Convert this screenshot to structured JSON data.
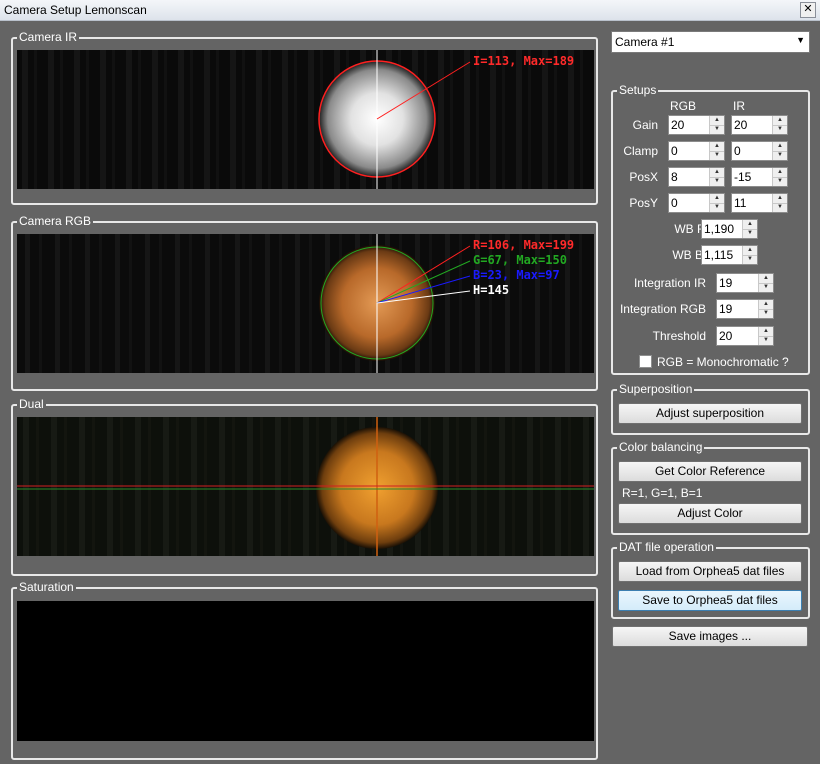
{
  "window": {
    "title": "Camera Setup Lemonscan",
    "close_glyph": "✕"
  },
  "panels": {
    "camera_ir": {
      "label": "Camera IR",
      "overlay": "I=113, Max=189"
    },
    "camera_rgb": {
      "label": "Camera RGB",
      "overlays": {
        "r": "R=106, Max=199",
        "g": "G=67, Max=150",
        "b": "B=23, Max=97",
        "h": "H=145"
      }
    },
    "dual": {
      "label": "Dual"
    },
    "saturation": {
      "label": "Saturation"
    }
  },
  "camera_select": {
    "value": "Camera #1",
    "arrow": "▼"
  },
  "setups": {
    "label": "Setups",
    "col_rgb": "RGB",
    "col_ir": "IR",
    "rows": {
      "gain": {
        "label": "Gain",
        "rgb": "20",
        "ir": "20"
      },
      "clamp": {
        "label": "Clamp",
        "rgb": "0",
        "ir": "0"
      },
      "posx": {
        "label": "PosX",
        "rgb": "8",
        "ir": "-15"
      },
      "posy": {
        "label": "PosY",
        "rgb": "0",
        "ir": "11"
      }
    },
    "wb_red": {
      "label": "WB Red",
      "value": "1,190"
    },
    "wb_blue": {
      "label": "WB Blue",
      "value": "1,115"
    },
    "integration_ir": {
      "label": "Integration IR",
      "value": "19"
    },
    "integration_rgb": {
      "label": "Integration RGB",
      "value": "19"
    },
    "threshold": {
      "label": "Threshold",
      "value": "20"
    },
    "monochrome": {
      "label": "RGB = Monochromatic ?",
      "checked": false
    },
    "spin_up": "▲",
    "spin_down": "▼"
  },
  "superposition": {
    "label": "Superposition",
    "adjust_button": "Adjust superposition"
  },
  "color_balancing": {
    "label": "Color balancing",
    "get_reference_button": "Get Color Reference",
    "result": "R=1, G=1, B=1",
    "adjust_button": "Adjust Color"
  },
  "dat_file": {
    "label": "DAT file operation",
    "load_button": "Load from Orphea5 dat files",
    "save_button": "Save to Orphea5 dat files"
  },
  "save_images_button": "Save images ...",
  "colors": {
    "background": "#646464",
    "overlay_red": "#ff2a2a",
    "overlay_green": "#22a822",
    "overlay_blue": "#1a1aff",
    "overlay_white": "#ffffff"
  }
}
